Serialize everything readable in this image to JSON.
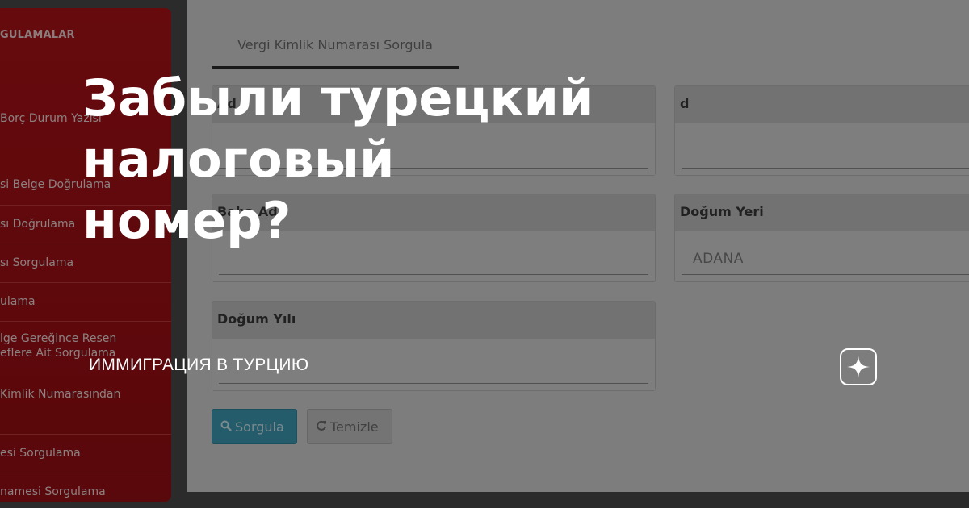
{
  "sidebar": {
    "header": "GULAMALAR",
    "items": [
      "Borç Durum Yazısı",
      "si Belge Doğrulama",
      "sı Doğrulama",
      "sı Sorgulama",
      "ulama",
      "lge Gereğince Resen",
      "eflere Ait Sorgulama",
      "Kimlik Numarasından",
      "esi Sorgulama",
      "namesi Sorgulama"
    ]
  },
  "main": {
    "tab_label": "Vergi Kimlik Numarası Sorgula",
    "fields": {
      "top_left_label": "Ad",
      "top_right_label": "d",
      "baba_adi_label": "Baba Adı",
      "dogum_yeri_label": "Doğum Yeri",
      "dogum_yeri_value": "ADANA",
      "dogum_yili_label": "Doğum Yılı"
    },
    "buttons": {
      "sorgula_label": "Sorgula",
      "temizle_label": "Temizle"
    }
  },
  "overlay": {
    "headline_line1": "Забыли турецкий налоговый",
    "headline_line2": "номер?",
    "channel_name": "ИММИГРАЦИЯ В ТУРЦИЮ"
  },
  "icons": {
    "search": "search-icon",
    "refresh": "refresh-icon",
    "logo": "zen-star-logo-icon"
  },
  "colors": {
    "sidebar_red": "#b01218",
    "button_blue": "#3f9fb9",
    "overlay_text": "#ffffff"
  }
}
